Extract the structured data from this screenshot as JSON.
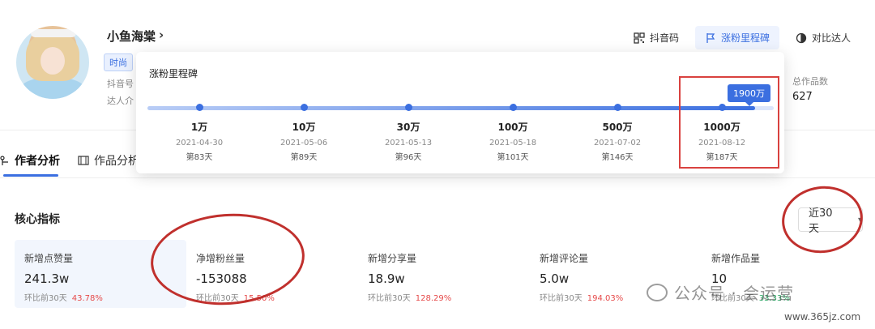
{
  "profile": {
    "name": "小鱼海棠",
    "chevron": "›",
    "tag": "时尚",
    "meta_line1": "抖音号",
    "meta_line2": "达人介"
  },
  "top_actions": [
    {
      "icon": "qr-code-icon",
      "label": "抖音码",
      "active": false
    },
    {
      "icon": "flag-icon",
      "label": "涨粉里程碑",
      "active": true
    },
    {
      "icon": "compare-icon",
      "label": "对比达人",
      "active": false
    }
  ],
  "stats": {
    "works_label": "总作品数",
    "works_value": "627"
  },
  "tabs": {
    "author_label": "作者分析",
    "works_label": "作品分析"
  },
  "milestones": {
    "title": "涨粉里程碑",
    "current_label": "1900万",
    "progress": 0.97,
    "items": [
      {
        "label": "1万",
        "date": "2021-04-30",
        "day": "第83天"
      },
      {
        "label": "10万",
        "date": "2021-05-06",
        "day": "第89天"
      },
      {
        "label": "30万",
        "date": "2021-05-13",
        "day": "第96天"
      },
      {
        "label": "100万",
        "date": "2021-05-18",
        "day": "第101天"
      },
      {
        "label": "500万",
        "date": "2021-07-02",
        "day": "第146天"
      },
      {
        "label": "1000万",
        "date": "2021-08-12",
        "day": "第187天"
      }
    ]
  },
  "core": {
    "title": "核心指标",
    "range": "近30天",
    "compare_label": "环比前30天",
    "cards": [
      {
        "label": "新增点赞量",
        "value": "241.3w",
        "pct": "43.78%",
        "trend": "up"
      },
      {
        "label": "净增粉丝量",
        "value": "-153088",
        "pct": "15.50%",
        "trend": "up"
      },
      {
        "label": "新增分享量",
        "value": "18.9w",
        "pct": "128.29%",
        "trend": "up"
      },
      {
        "label": "新增评论量",
        "value": "5.0w",
        "pct": "194.03%",
        "trend": "up"
      },
      {
        "label": "新增作品量",
        "value": "10",
        "pct": "33.33%",
        "trend": "down"
      }
    ]
  },
  "watermark": {
    "main": "公众号 · 会运营",
    "site": "www.365jz.com"
  },
  "colors": {
    "accent": "#3b6fe0",
    "annotation_red": "#c0302d",
    "positive": "#e64a4a",
    "negative": "#2fae6a"
  }
}
